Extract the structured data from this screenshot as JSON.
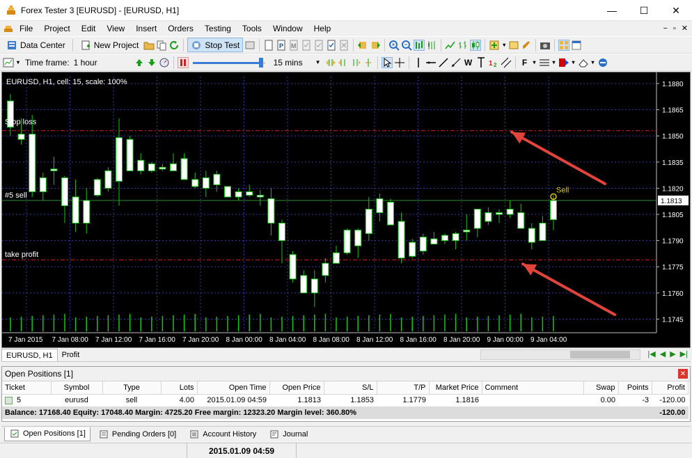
{
  "window": {
    "title": "Forex Tester 3  [EURUSD]  - [EURUSD, H1]",
    "minimize": "—",
    "maximize": "☐",
    "close": "✕"
  },
  "menu": [
    "File",
    "Project",
    "Edit",
    "View",
    "Insert",
    "Orders",
    "Testing",
    "Tools",
    "Window",
    "Help"
  ],
  "mdi_controls": [
    "−",
    "▫",
    "✕"
  ],
  "toolbar": {
    "data_center": "Data Center",
    "new_project": "New Project",
    "stop_test": "Stop Test",
    "text_tool": "W",
    "font_tool": "F"
  },
  "timeframe": {
    "label": "Time frame:",
    "value": "1 hour",
    "speed_value": "15 mins"
  },
  "chart": {
    "header": "EURUSD, H1, cell: 15, scale: 100%",
    "labels": {
      "stop_loss": "Stop loss",
      "position": "#5 sell",
      "take_profit": "take profit",
      "sell_marker": "Sell"
    },
    "current_price": "1.1813",
    "colors": {
      "background": "#000000",
      "bull": "#ffffff",
      "bear": "#ffffff",
      "wick": "#19c419",
      "stop": "#e02020",
      "price_line": "#2e8b2e",
      "grid": "#3a3a9a",
      "arrow": "#e0443a",
      "marker": "#e6c619"
    }
  },
  "chart_data": {
    "type": "candlestick",
    "title": "EURUSD, H1",
    "y_ticks": [
      "1.1880",
      "1.1865",
      "1.1850",
      "1.1835",
      "1.1820",
      "1.1805",
      "1.1790",
      "1.1775",
      "1.1760",
      "1.1745"
    ],
    "x_ticks": [
      "7 Jan 2015",
      "7 Jan 08:00",
      "7 Jan 12:00",
      "7 Jan 16:00",
      "7 Jan 20:00",
      "8 Jan 00:00",
      "8 Jan 04:00",
      "8 Jan 08:00",
      "8 Jan 12:00",
      "8 Jan 16:00",
      "8 Jan 20:00",
      "9 Jan 00:00",
      "9 Jan 04:00"
    ],
    "ylim": [
      1.1738,
      1.1884
    ],
    "levels": {
      "stop_loss": 1.1853,
      "entry": 1.1813,
      "take_profit": 1.1779
    },
    "candles": [
      [
        1.187,
        1.1874,
        1.185,
        1.1855
      ],
      [
        1.1851,
        1.186,
        1.1845,
        1.1848
      ],
      [
        1.1851,
        1.1862,
        1.1815,
        1.1818
      ],
      [
        1.1818,
        1.1829,
        1.1813,
        1.1826
      ],
      [
        1.1831,
        1.1838,
        1.1822,
        1.183
      ],
      [
        1.1826,
        1.1827,
        1.18,
        1.181
      ],
      [
        1.1815,
        1.1825,
        1.1795,
        1.18
      ],
      [
        1.18,
        1.182,
        1.1794,
        1.1813
      ],
      [
        1.1825,
        1.1826,
        1.1815,
        1.1816
      ],
      [
        1.182,
        1.1832,
        1.1818,
        1.183
      ],
      [
        1.1824,
        1.186,
        1.181,
        1.1849
      ],
      [
        1.1848,
        1.185,
        1.183,
        1.183
      ],
      [
        1.183,
        1.184,
        1.1828,
        1.1836
      ],
      [
        1.183,
        1.1835,
        1.1829,
        1.1834
      ],
      [
        1.1832,
        1.1834,
        1.183,
        1.1831
      ],
      [
        1.1834,
        1.184,
        1.183,
        1.183
      ],
      [
        1.1837,
        1.184,
        1.1825,
        1.1825
      ],
      [
        1.1825,
        1.1829,
        1.182,
        1.1821
      ],
      [
        1.182,
        1.183,
        1.1815,
        1.1826
      ],
      [
        1.1828,
        1.183,
        1.1818,
        1.1822
      ],
      [
        1.1821,
        1.1821,
        1.1815,
        1.1815
      ],
      [
        1.1815,
        1.182,
        1.1813,
        1.1818
      ],
      [
        1.1818,
        1.1822,
        1.1815,
        1.1816
      ],
      [
        1.1816,
        1.1819,
        1.181,
        1.1815
      ],
      [
        1.1814,
        1.182,
        1.1793,
        1.18
      ],
      [
        1.18,
        1.1802,
        1.1777,
        1.179
      ],
      [
        1.1782,
        1.1784,
        1.1766,
        1.1768
      ],
      [
        1.177,
        1.1773,
        1.176,
        1.176
      ],
      [
        1.176,
        1.1773,
        1.1752,
        1.1768
      ],
      [
        1.177,
        1.178,
        1.1766,
        1.1777
      ],
      [
        1.1777,
        1.1787,
        1.1778,
        1.1783
      ],
      [
        1.1783,
        1.1797,
        1.1782,
        1.1796
      ],
      [
        1.1796,
        1.1797,
        1.178,
        1.1787
      ],
      [
        1.1794,
        1.1815,
        1.179,
        1.1808
      ],
      [
        1.1806,
        1.1817,
        1.1801,
        1.1814
      ],
      [
        1.1812,
        1.1814,
        1.1799,
        1.1799
      ],
      [
        1.1801,
        1.1806,
        1.1777,
        1.178
      ],
      [
        1.1781,
        1.1791,
        1.178,
        1.1789
      ],
      [
        1.1784,
        1.1794,
        1.1782,
        1.1792
      ],
      [
        1.1791,
        1.1795,
        1.1788,
        1.1788
      ],
      [
        1.179,
        1.1794,
        1.1788,
        1.1793
      ],
      [
        1.179,
        1.1795,
        1.1785,
        1.1794
      ],
      [
        1.1795,
        1.1805,
        1.179,
        1.1796
      ],
      [
        1.1797,
        1.1802,
        1.1792,
        1.1808
      ],
      [
        1.1801,
        1.1809,
        1.1799,
        1.1806
      ],
      [
        1.1805,
        1.1808,
        1.18,
        1.1806
      ],
      [
        1.1805,
        1.1813,
        1.1803,
        1.1808
      ],
      [
        1.1806,
        1.1811,
        1.1797,
        1.1797
      ],
      [
        1.1797,
        1.18,
        1.1785,
        1.1789
      ],
      [
        1.179,
        1.1804,
        1.179,
        1.18
      ],
      [
        1.1802,
        1.1816,
        1.1796,
        1.1813
      ]
    ],
    "volume": true
  },
  "chart_tabs": {
    "active": "EURUSD, H1",
    "other": "Profit"
  },
  "panel": {
    "title": "Open Positions [1]",
    "columns": [
      "Ticket",
      "Symbol",
      "Type",
      "Lots",
      "Open Time",
      "Open Price",
      "S/L",
      "T/P",
      "Market Price",
      "Comment",
      "Swap",
      "Points",
      "Profit"
    ],
    "row": {
      "ticket": "5",
      "symbol": "eurusd",
      "type": "sell",
      "lots": "4.00",
      "open_time": "2015.01.09 04:59",
      "open_price": "1.1813",
      "sl": "1.1853",
      "tp": "1.1779",
      "market_price": "1.1816",
      "comment": "",
      "swap": "0.00",
      "points": "-3",
      "profit": "-120.00"
    },
    "balance_text": "Balance: 17168.40 Equity: 17048.40 Margin: 4725.20 Free margin: 12323.20 Margin level: 360.80%",
    "balance_profit": "-120.00"
  },
  "bottom_tabs": [
    "Open Positions [1]",
    "Pending Orders [0]",
    "Account History",
    "Journal"
  ],
  "status": {
    "time": "2015.01.09 04:59"
  }
}
